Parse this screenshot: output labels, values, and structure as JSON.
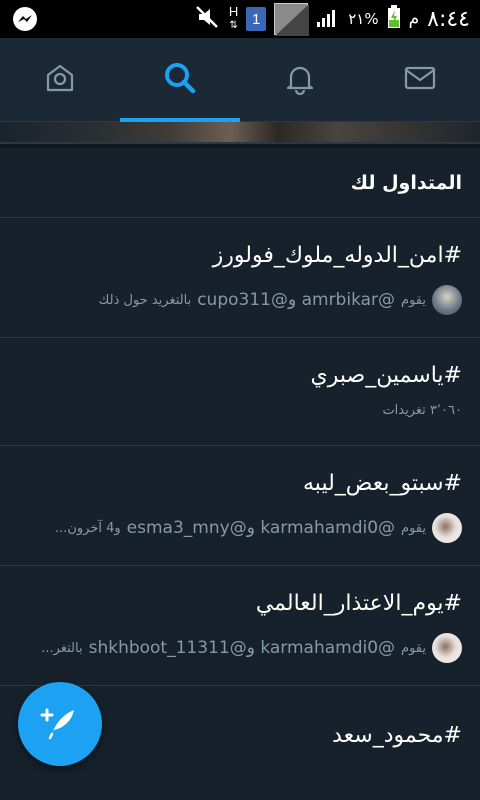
{
  "status_bar": {
    "time": "٨:٤٤",
    "ampm": "م",
    "battery_percent": "٢١%",
    "sim_label": "1",
    "data_label": "H",
    "icons": [
      "messenger-icon",
      "mute-icon",
      "data-h-icon",
      "sim-1-icon",
      "signal-icon",
      "battery-charging-icon"
    ]
  },
  "tabs": [
    {
      "name": "home",
      "icon": "home-icon",
      "active": false
    },
    {
      "name": "search",
      "icon": "search-icon",
      "active": true
    },
    {
      "name": "notifications",
      "icon": "bell-icon",
      "active": false
    },
    {
      "name": "messages",
      "icon": "mail-icon",
      "active": false
    }
  ],
  "colors": {
    "accent": "#1da1f2",
    "background": "#16212c",
    "bar": "#1b2836",
    "secondary_text": "#8899a6"
  },
  "section": {
    "title": "المتداول لك"
  },
  "trends": [
    {
      "tag": "#امن_الدوله_ملوك_فولورز",
      "meta_prefix": "يقوم",
      "meta_users": "@amrbikar و@cupo311",
      "meta_suffix": "بالتغريد حول ذلك"
    },
    {
      "tag": "#ياسمين_صبري",
      "count": "٣٬٠٦٠ تغريدات"
    },
    {
      "tag": "#سبتو_بعض_ليبه",
      "meta_prefix": "يقوم",
      "meta_users": "@karmahamdi0 و@esma3_mny",
      "meta_suffix": "و4 آخرون..."
    },
    {
      "tag": "#يوم_الاعتذار_العالمي",
      "meta_prefix": "يقوم",
      "meta_users": "@karmahamdi0 و@shkhboot_11311",
      "meta_suffix": "بالتغر..."
    },
    {
      "tag": "#محمود_سعد"
    }
  ],
  "fab": {
    "icon": "compose-tweet-icon"
  }
}
